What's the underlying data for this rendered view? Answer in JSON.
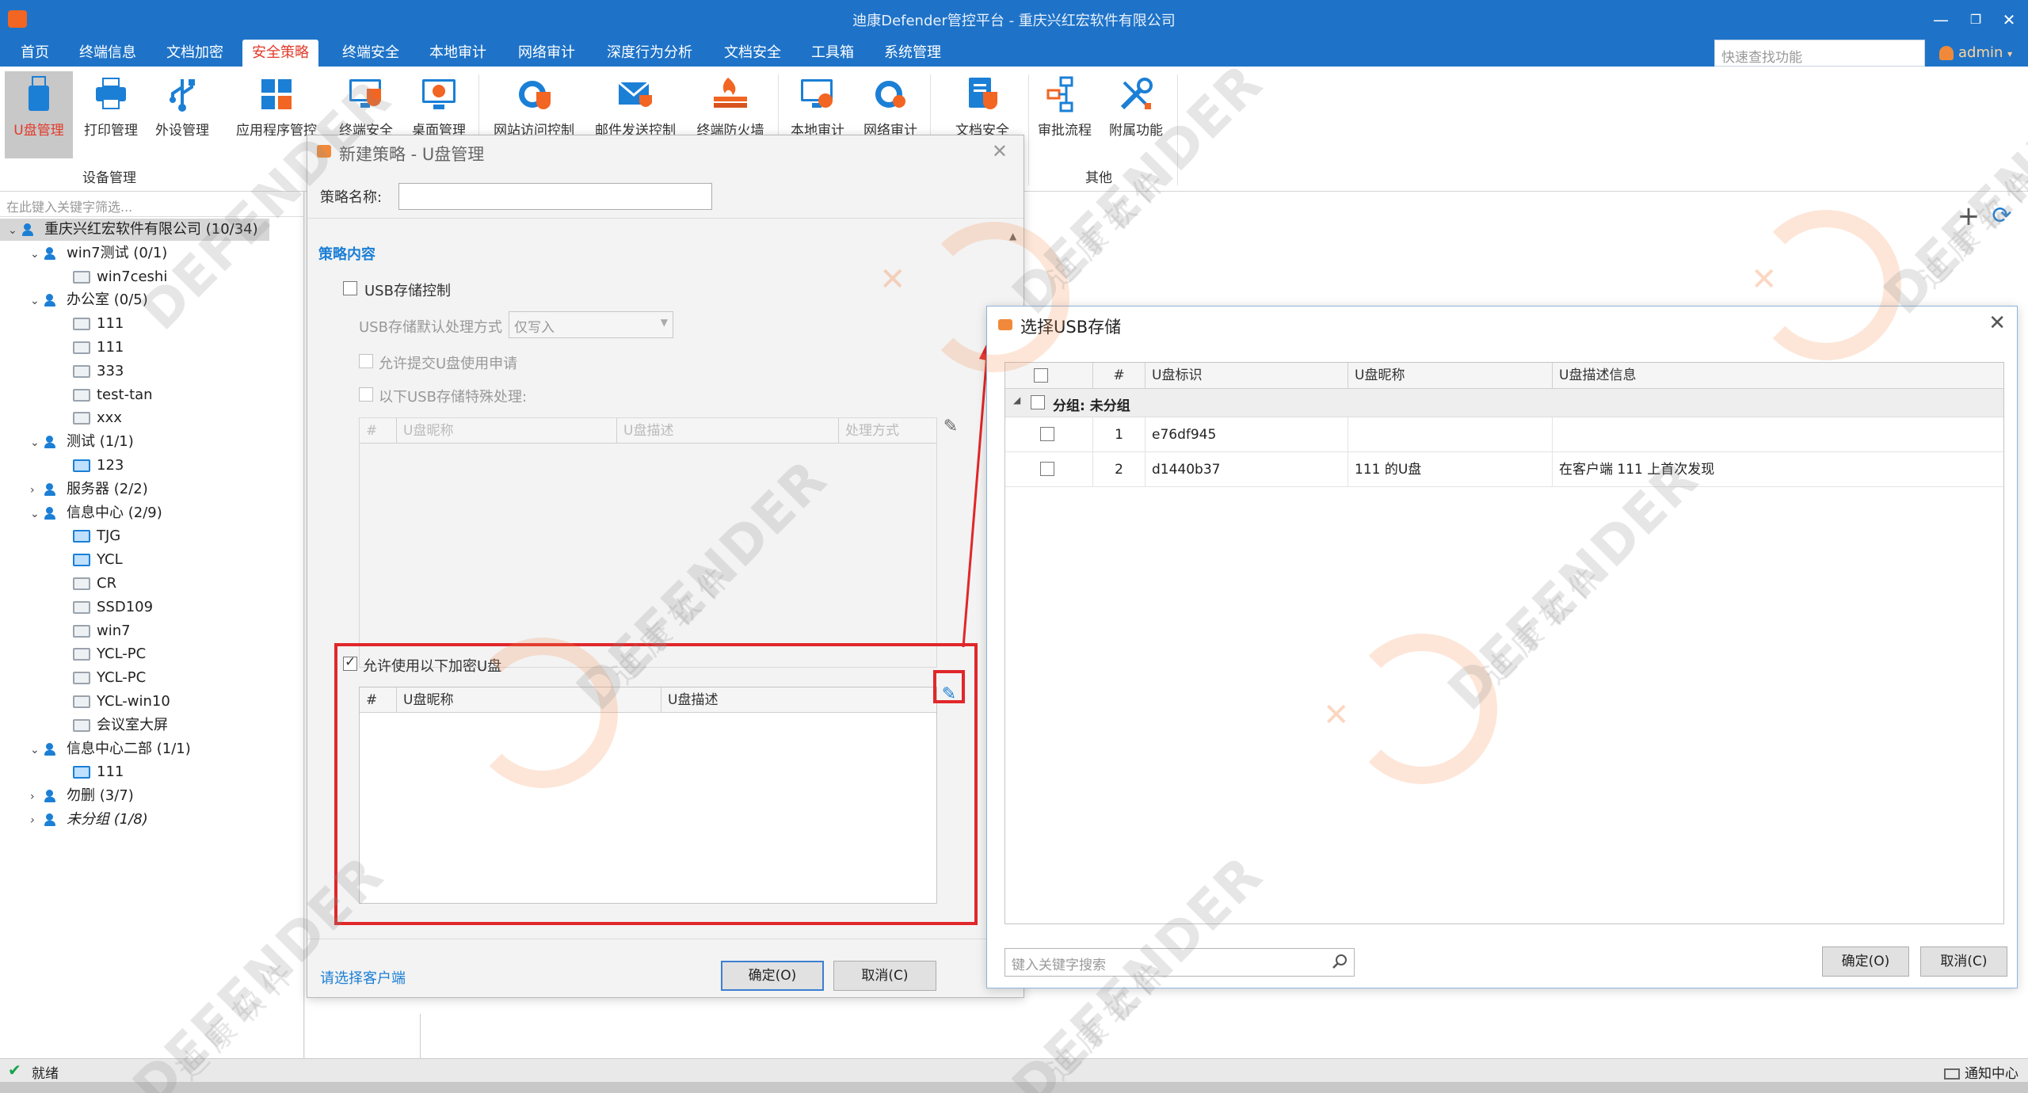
{
  "window": {
    "title": "迪康Defender管控平台 - 重庆兴红宏软件有限公司",
    "min": "—",
    "restore": "❐",
    "close": "✕"
  },
  "menu": {
    "items": [
      "首页",
      "终端信息",
      "文档加密",
      "安全策略",
      "终端安全",
      "本地审计",
      "网络审计",
      "深度行为分析",
      "文档安全",
      "工具箱",
      "系统管理"
    ],
    "active_index": 3,
    "quick_search_placeholder": "快速查找功能",
    "user": "admin",
    "user_caret": "▾"
  },
  "ribbon": {
    "buttons": [
      {
        "label": "U盘管理",
        "icon": "usb-drive-icon"
      },
      {
        "label": "打印管理",
        "icon": "printer-icon"
      },
      {
        "label": "外设管理",
        "icon": "usb-symbol-icon"
      },
      {
        "label": "应用程序管控",
        "icon": "app-grid-icon"
      },
      {
        "label": "终端安全",
        "icon": "monitor-shield-icon"
      },
      {
        "label": "桌面管理",
        "icon": "monitor-gear-icon"
      },
      {
        "label": "网站访问控制",
        "icon": "ie-shield-icon"
      },
      {
        "label": "邮件发送控制",
        "icon": "mail-shield-icon"
      },
      {
        "label": "终端防火墙",
        "icon": "firewall-icon"
      },
      {
        "label": "本地审计",
        "icon": "monitor-audit-icon"
      },
      {
        "label": "网络审计",
        "icon": "ie-audit-icon"
      },
      {
        "label": "文档安全",
        "icon": "document-shield-icon"
      },
      {
        "label": "审批流程",
        "icon": "approval-flow-icon"
      },
      {
        "label": "附属功能",
        "icon": "tools-icon"
      }
    ],
    "group_device": "设备管理",
    "group_other": "其他"
  },
  "tree": {
    "filter_placeholder": "在此键入关键字筛选...",
    "nodes": [
      {
        "label": "重庆兴红宏软件有限公司 (10/34)",
        "level": 0,
        "type": "group",
        "expand": "open"
      },
      {
        "label": "win7测试 (0/1)",
        "level": 1,
        "type": "group",
        "expand": "open"
      },
      {
        "label": "win7ceshi",
        "level": 2,
        "type": "pc"
      },
      {
        "label": "办公室 (0/5)",
        "level": 1,
        "type": "group",
        "expand": "open"
      },
      {
        "label": "111",
        "level": 2,
        "type": "pc"
      },
      {
        "label": "111",
        "level": 2,
        "type": "pc"
      },
      {
        "label": "333",
        "level": 2,
        "type": "pc"
      },
      {
        "label": "test-tan",
        "level": 2,
        "type": "pc"
      },
      {
        "label": "xxx",
        "level": 2,
        "type": "pc"
      },
      {
        "label": "测试 (1/1)",
        "level": 1,
        "type": "group",
        "expand": "open"
      },
      {
        "label": "123",
        "level": 2,
        "type": "pc-on"
      },
      {
        "label": "服务器 (2/2)",
        "level": 1,
        "type": "group",
        "expand": "closed"
      },
      {
        "label": "信息中心 (2/9)",
        "level": 1,
        "type": "group",
        "expand": "open"
      },
      {
        "label": "TJG",
        "level": 2,
        "type": "pc-on"
      },
      {
        "label": "YCL",
        "level": 2,
        "type": "pc-on"
      },
      {
        "label": "CR",
        "level": 2,
        "type": "pc"
      },
      {
        "label": "SSD109",
        "level": 2,
        "type": "pc"
      },
      {
        "label": "win7",
        "level": 2,
        "type": "pc"
      },
      {
        "label": "YCL-PC",
        "level": 2,
        "type": "pc"
      },
      {
        "label": "YCL-PC",
        "level": 2,
        "type": "pc"
      },
      {
        "label": "YCL-win10",
        "level": 2,
        "type": "pc"
      },
      {
        "label": "会议室大屏",
        "level": 2,
        "type": "pc"
      },
      {
        "label": "信息中心二部 (1/1)",
        "level": 1,
        "type": "group",
        "expand": "open"
      },
      {
        "label": "111",
        "level": 2,
        "type": "pc-on"
      },
      {
        "label": "勿删 (3/7)",
        "level": 1,
        "type": "group",
        "expand": "closed"
      },
      {
        "label": "未分组 (1/8)",
        "level": 1,
        "type": "group",
        "expand": "closed",
        "italic": true
      }
    ]
  },
  "dialog_policy": {
    "title": "新建策略 - U盘管理",
    "close": "✕",
    "name_label": "策略名称:",
    "name_value": "",
    "section_title": "策略内容",
    "usb_control_label": "USB存储控制",
    "default_mode_label": "USB存储默认处理方式",
    "default_mode_value": "仅写入",
    "allow_apply_label": "允许提交U盘使用申请",
    "special_label": "以下USB存储特殊处理:",
    "special_columns": [
      "#",
      "U盘昵称",
      "U盘描述",
      "处理方式"
    ],
    "allow_encrypted_label": "允许使用以下加密U盘",
    "encrypted_checked": true,
    "encrypted_columns": [
      "#",
      "U盘昵称",
      "U盘描述"
    ],
    "select_clients_link": "请选择客户端",
    "ok_label": "确定(O)",
    "cancel_label": "取消(C)"
  },
  "dialog_usb": {
    "title": "选择USB存储",
    "close": "✕",
    "columns": [
      "",
      "#",
      "U盘标识",
      "U盘昵称",
      "U盘描述信息"
    ],
    "group_label": "分组: 未分组",
    "rows": [
      {
        "index": "1",
        "id": "e76df945",
        "nickname": "",
        "desc": ""
      },
      {
        "index": "2",
        "id": "d1440b37",
        "nickname": "111 的U盘",
        "desc": "在客户端 111 上首次发现"
      }
    ],
    "search_placeholder": "键入关键字搜索",
    "ok_label": "确定(O)",
    "cancel_label": "取消(C)"
  },
  "status": {
    "text": "就绪",
    "notify": "通知中心"
  },
  "watermark": {
    "brand": "DEFENDER",
    "sub": "迪 康 软 件"
  },
  "colors": {
    "titlebar": "#1e73c8",
    "highlight": "#e0272a",
    "accent_blue": "#1b7fd6",
    "brand_orange": "#f08a3a"
  }
}
